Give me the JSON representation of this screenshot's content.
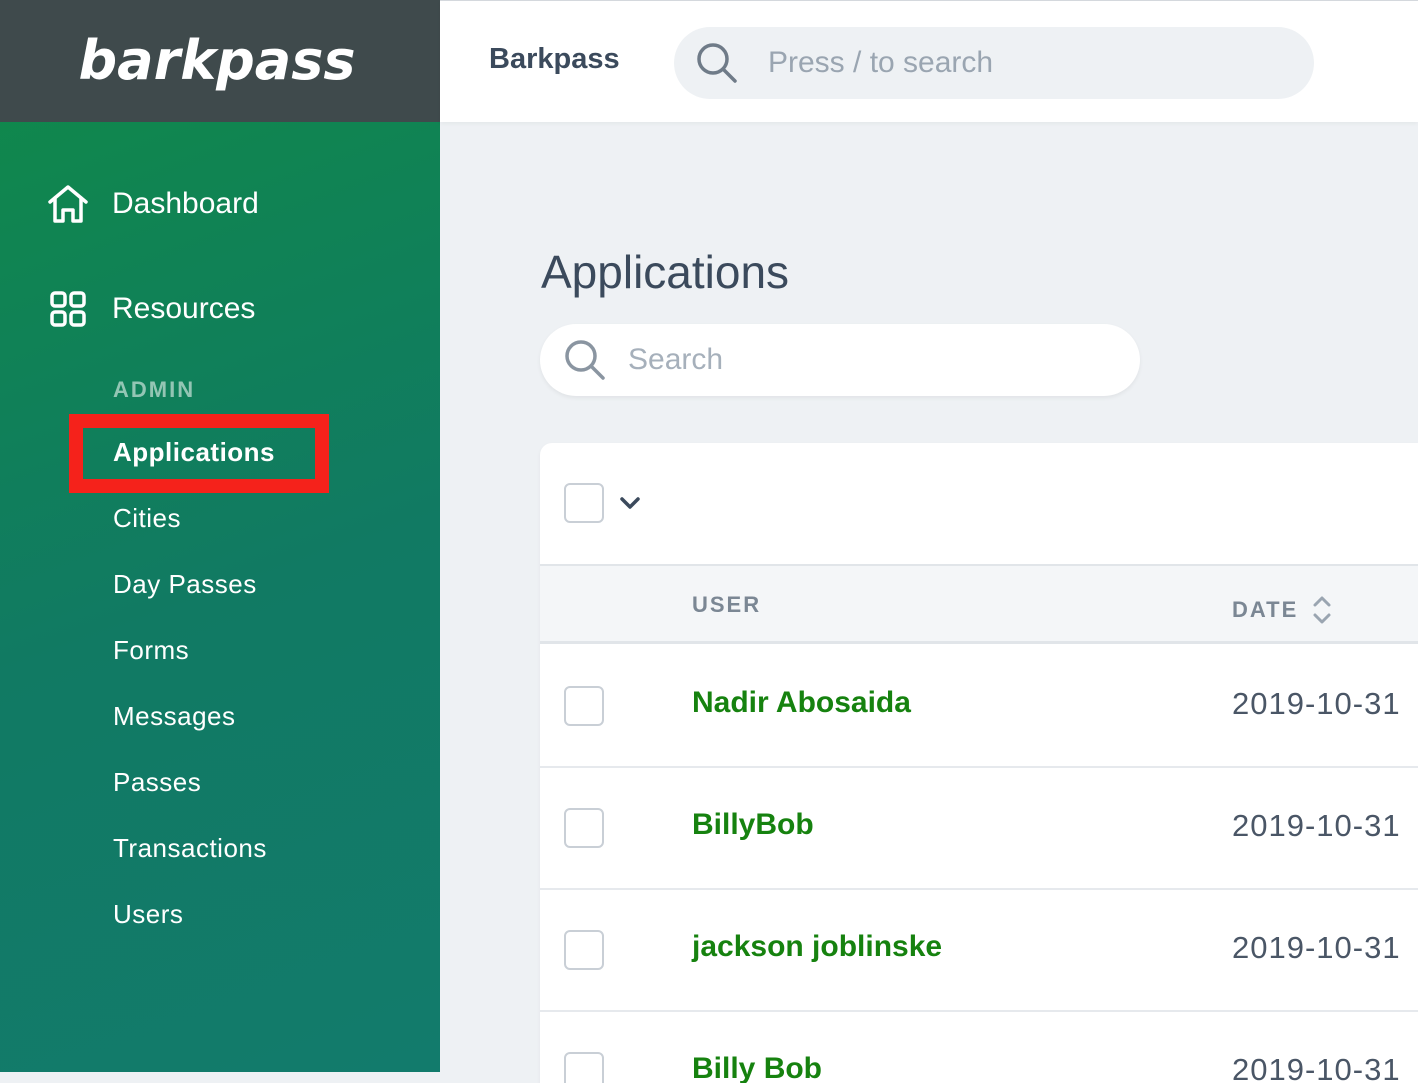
{
  "brand": {
    "logo_text": "barkpass"
  },
  "topbar": {
    "title": "Barkpass",
    "search_placeholder": "Press / to search"
  },
  "sidebar": {
    "dashboard_label": "Dashboard",
    "resources_label": "Resources",
    "section_label": "ADMIN",
    "items": [
      {
        "label": "Applications",
        "active": true
      },
      {
        "label": "Cities"
      },
      {
        "label": "Day Passes"
      },
      {
        "label": "Forms"
      },
      {
        "label": "Messages"
      },
      {
        "label": "Passes"
      },
      {
        "label": "Transactions"
      },
      {
        "label": "Users"
      }
    ]
  },
  "main": {
    "title": "Applications",
    "search_placeholder": "Search",
    "table": {
      "columns": [
        "USER",
        "DATE"
      ],
      "rows": [
        {
          "user": "Nadir Abosaida",
          "date": "2019-10-31"
        },
        {
          "user": "BillyBob",
          "date": "2019-10-31"
        },
        {
          "user": "jackson joblinske",
          "date": "2019-10-31"
        },
        {
          "user": "Billy Bob",
          "date": "2019-10-31"
        }
      ]
    }
  },
  "colors": {
    "sidebar_green": "#0f8a48",
    "sidebar_teal": "#127b6c",
    "brand_bar": "#3f4a4c",
    "link_green": "#16820f",
    "highlight_red": "#f5221b"
  }
}
